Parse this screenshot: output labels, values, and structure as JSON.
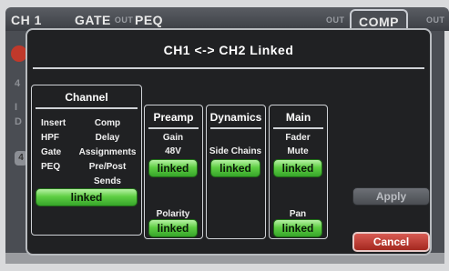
{
  "background": {
    "channel_tab": "CH 1",
    "gate_tab": "GATE",
    "gate_tab_suffix": "OUT",
    "peq_tab": "PEQ",
    "mid_out": "OUT",
    "comp_tab": "COMP",
    "comp_out": "OUT",
    "left_marker_a": "4",
    "left_marker_b": "I",
    "left_marker_c": "D",
    "left_marker_knob": "4"
  },
  "dialog": {
    "title": "CH1 <-> CH2 Linked",
    "channel": {
      "title": "Channel",
      "left_items": [
        "Insert",
        "HPF",
        "Gate",
        "PEQ"
      ],
      "right_items": [
        "Comp",
        "Delay",
        "Assignments",
        "Pre/Post",
        "Sends"
      ],
      "linked_label": "linked"
    },
    "preamp": {
      "title": "Preamp",
      "items": [
        "Gain",
        "48V"
      ],
      "linked_label": "linked",
      "polarity_label": "Polarity",
      "polarity_linked_label": "linked"
    },
    "dynamics": {
      "title": "Dynamics",
      "items": [
        "Side Chains"
      ],
      "linked_label": "linked"
    },
    "main": {
      "title": "Main",
      "items": [
        "Fader",
        "Mute"
      ],
      "linked_label": "linked",
      "pan_label": "Pan",
      "pan_linked_label": "linked"
    },
    "apply_label": "Apply",
    "cancel_label": "Cancel"
  }
}
